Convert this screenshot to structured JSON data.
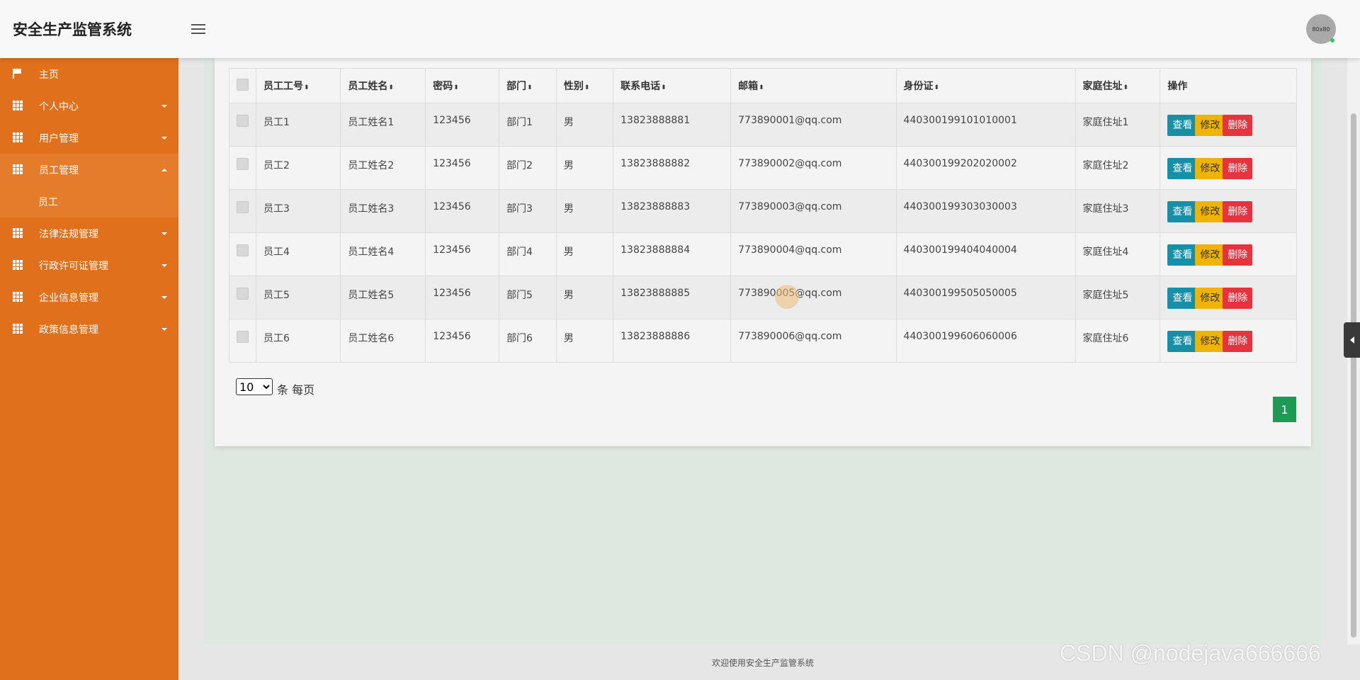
{
  "header": {
    "app_title": "安全生产监管系统",
    "avatar_text": "80x80"
  },
  "sidebar": {
    "items": [
      {
        "label": "主页",
        "icon": "flag-icon",
        "expanded": false
      },
      {
        "label": "个人中心",
        "icon": "grid-icon",
        "expanded": false
      },
      {
        "label": "用户管理",
        "icon": "grid-icon",
        "expanded": false
      },
      {
        "label": "员工管理",
        "icon": "grid-icon",
        "expanded": true,
        "children": [
          {
            "label": "员工"
          }
        ]
      },
      {
        "label": "法律法规管理",
        "icon": "grid-icon",
        "expanded": false
      },
      {
        "label": "行政许可证管理",
        "icon": "grid-icon",
        "expanded": false
      },
      {
        "label": "企业信息管理",
        "icon": "grid-icon",
        "expanded": false
      },
      {
        "label": "政策信息管理",
        "icon": "grid-icon",
        "expanded": false
      }
    ]
  },
  "table": {
    "columns": [
      "员工工号",
      "员工姓名",
      "密码",
      "部门",
      "性别",
      "联系电话",
      "邮箱",
      "身份证",
      "家庭住址",
      "操作"
    ],
    "rows": [
      [
        "员工1",
        "员工姓名1",
        "123456",
        "部门1",
        "男",
        "13823888881",
        "773890001@qq.com",
        "440300199101010001",
        "家庭住址1"
      ],
      [
        "员工2",
        "员工姓名2",
        "123456",
        "部门2",
        "男",
        "13823888882",
        "773890002@qq.com",
        "440300199202020002",
        "家庭住址2"
      ],
      [
        "员工3",
        "员工姓名3",
        "123456",
        "部门3",
        "男",
        "13823888883",
        "773890003@qq.com",
        "440300199303030003",
        "家庭住址3"
      ],
      [
        "员工4",
        "员工姓名4",
        "123456",
        "部门4",
        "男",
        "13823888884",
        "773890004@qq.com",
        "440300199404040004",
        "家庭住址4"
      ],
      [
        "员工5",
        "员工姓名5",
        "123456",
        "部门5",
        "男",
        "13823888885",
        "773890005@qq.com",
        "440300199505050005",
        "家庭住址5"
      ],
      [
        "员工6",
        "员工姓名6",
        "123456",
        "部门6",
        "男",
        "13823888886",
        "773890006@qq.com",
        "440300199606060006",
        "家庭住址6"
      ]
    ],
    "actions": {
      "view": "查看",
      "edit": "修改",
      "delete": "删除"
    }
  },
  "pager": {
    "page_size": "10",
    "page_size_suffix": "条 每页",
    "current_page": "1"
  },
  "footer": {
    "text": "欢迎使用安全生产监管系统"
  },
  "watermark": "CSDN @nodejava666666",
  "colors": {
    "sidebar": "#e0701b",
    "view_button": "#1690a8",
    "edit_button": "#f0b400",
    "delete_button": "#e8323e",
    "page_active": "#1e9a57"
  }
}
